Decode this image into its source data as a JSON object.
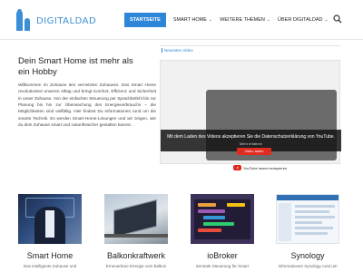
{
  "header": {
    "logo_text": "DIGITALDAD",
    "nav": [
      {
        "label": "STARTSEITE",
        "dropdown": false,
        "active": true
      },
      {
        "label": "SMART HOME",
        "dropdown": true,
        "active": false
      },
      {
        "label": "WEITERE THEMEN",
        "dropdown": true,
        "active": false
      },
      {
        "label": "ÜBER DIGITALDAD",
        "dropdown": true,
        "active": false
      }
    ],
    "search_icon": "search-icon"
  },
  "hero": {
    "title": "Dein Smart Home ist mehr als ein Hobby",
    "text": "Willkommen im Zuhause des vernetzten Zuhauses. Das Smart Home revolutioniert unseren Alltag und bringt Komfort, Effizienz und Sicherheit in unser Zuhause. Von der einfachen Steuerung per Sprachbefehl bis zur Planung bis hin zur Überwachung des Energieverbrauchs – die Möglichkeiten sind vielfältig. Hier findest Du Informationen rund um die smarte Technik. Es werden Smart-Home-Lösungen und wir zeigen, wie du dein Zuhause smart und zukunftssicher gestalten kannst."
  },
  "video": {
    "section_label": "Neuestes Video",
    "caption": "Mit dem Laden des Videos akzeptieren Sie die Datenschutzerklärung von YouTube.",
    "link_text": "Mehr erfahren",
    "button_label": "Video laden",
    "yt_label": "YouTube immer entsperren"
  },
  "cards": [
    {
      "title": "Smart Home",
      "subtitle": "Das intelligente Zuhause und"
    },
    {
      "title": "Balkonkraftwerk",
      "subtitle": "Erneuerbare Energie vom Balkon"
    },
    {
      "title": "ioBroker",
      "subtitle": "Zentrale Steuerung für Smart"
    },
    {
      "title": "Synology",
      "subtitle": "Informationen Synology rund um"
    }
  ],
  "colors": {
    "accent": "#2e86d9",
    "youtube_red": "#e02b20"
  }
}
